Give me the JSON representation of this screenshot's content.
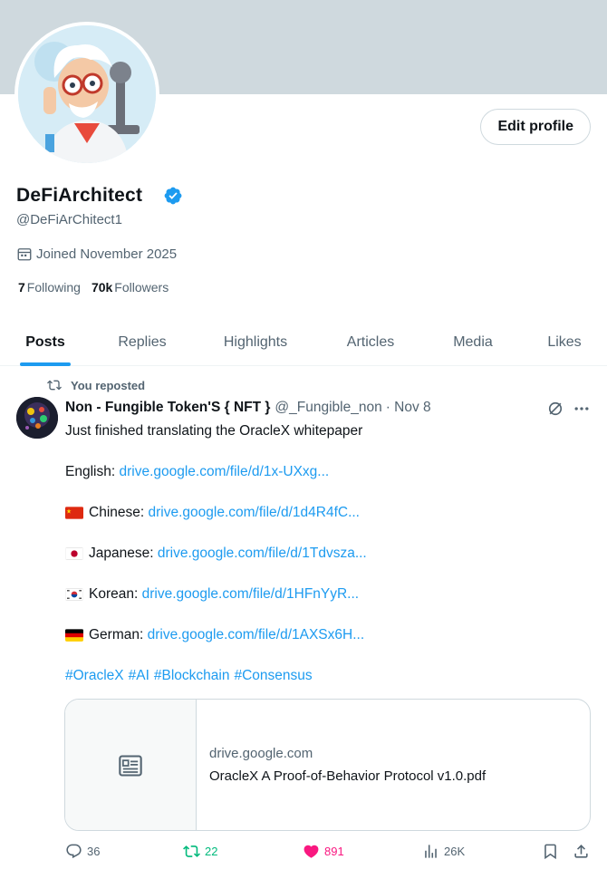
{
  "profile": {
    "display_name": "DeFiArchitect",
    "handle": "@DeFiArChitect1",
    "joined": "Joined November 2025",
    "following_count": "7",
    "following_label": "Following",
    "followers_count": "70k",
    "followers_label": "Followers",
    "edit_button": "Edit profile",
    "verified": true
  },
  "tabs": [
    {
      "label": "Posts",
      "active": true
    },
    {
      "label": "Replies",
      "active": false
    },
    {
      "label": "Highlights",
      "active": false
    },
    {
      "label": "Articles",
      "active": false
    },
    {
      "label": "Media",
      "active": false
    },
    {
      "label": "Likes",
      "active": false
    }
  ],
  "post": {
    "repost_label": "You reposted",
    "author": "Non - Fungible Token'S { NFT }",
    "handle": "@_Fungible_non",
    "date": "· Nov 8",
    "intro": "Just finished translating the OracleX whitepaper",
    "translations": [
      {
        "language": "English:",
        "link": "drive.google.com/file/d/1x-UXxg...",
        "flag": "none"
      },
      {
        "language": "Chinese:",
        "link": "drive.google.com/file/d/1d4R4fC...",
        "flag": "china-flag"
      },
      {
        "language": "Japanese:",
        "link": "drive.google.com/file/d/1Tdvsza...",
        "flag": "japan-flag"
      },
      {
        "language": "Korean:",
        "link": "drive.google.com/file/d/1HFnYyR...",
        "flag": "korea-flag"
      },
      {
        "language": "German:",
        "link": "drive.google.com/file/d/1AXSx6H...",
        "flag": "germany-flag"
      }
    ],
    "hashtags": [
      "#OracleX",
      "#AI",
      "#Blockchain",
      "#Consensus"
    ],
    "card": {
      "domain": "drive.google.com",
      "title": "OracleX A Proof-of-Behavior Protocol v1.0.pdf"
    },
    "stats": {
      "replies": "36",
      "reposts": "22",
      "likes": "891",
      "views": "26K"
    }
  },
  "colors": {
    "accent": "#1d9bf0",
    "repost_green": "#00ba7c",
    "like_pink": "#f91880",
    "muted": "#536471",
    "banner": "#cfd9de"
  }
}
